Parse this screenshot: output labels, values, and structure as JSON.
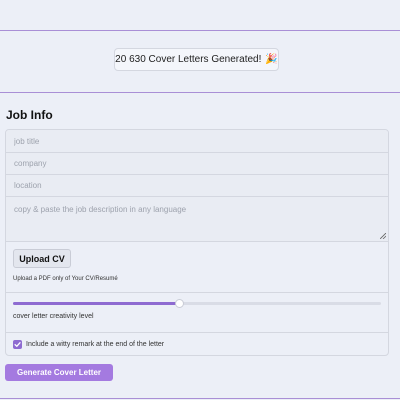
{
  "counter": {
    "text": "20 630 Cover Letters Generated!",
    "emoji": "🎉"
  },
  "job_info": {
    "title": "Job Info",
    "fields": {
      "job_title_placeholder": "job title",
      "company_placeholder": "company",
      "location_placeholder": "location",
      "description_placeholder": "copy & paste the job description in any language"
    }
  },
  "upload": {
    "button_label": "Upload CV",
    "hint": "Upload a PDF only of Your CV/Resumé"
  },
  "creativity": {
    "label": "cover letter creativity level",
    "value": 0.45
  },
  "witty": {
    "label": "Include a witty remark at the end of the letter",
    "checked": true
  },
  "generate_label": "Generate Cover Letter",
  "colors": {
    "accent": "#8e6bd1",
    "button": "#a47ae0",
    "divider": "#a98fd6",
    "background": "#eceff7"
  }
}
